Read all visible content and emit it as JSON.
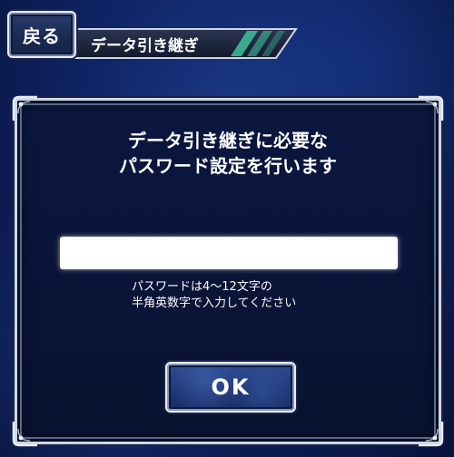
{
  "header": {
    "back_label": "戻る",
    "title": "データ引き継ぎ"
  },
  "dialog": {
    "message_line1": "データ引き継ぎに必要な",
    "message_line2": "パスワード設定を行います",
    "password_value": "",
    "hint_line1": "パスワードは4～12文字の",
    "hint_line2": "半角英数字で入力してください",
    "ok_label": "OK"
  },
  "colors": {
    "background": "#0f2466",
    "dialog_background": "#0a1436",
    "frame": "#cfd6e3",
    "banner_accent": "#3fbf9a"
  }
}
